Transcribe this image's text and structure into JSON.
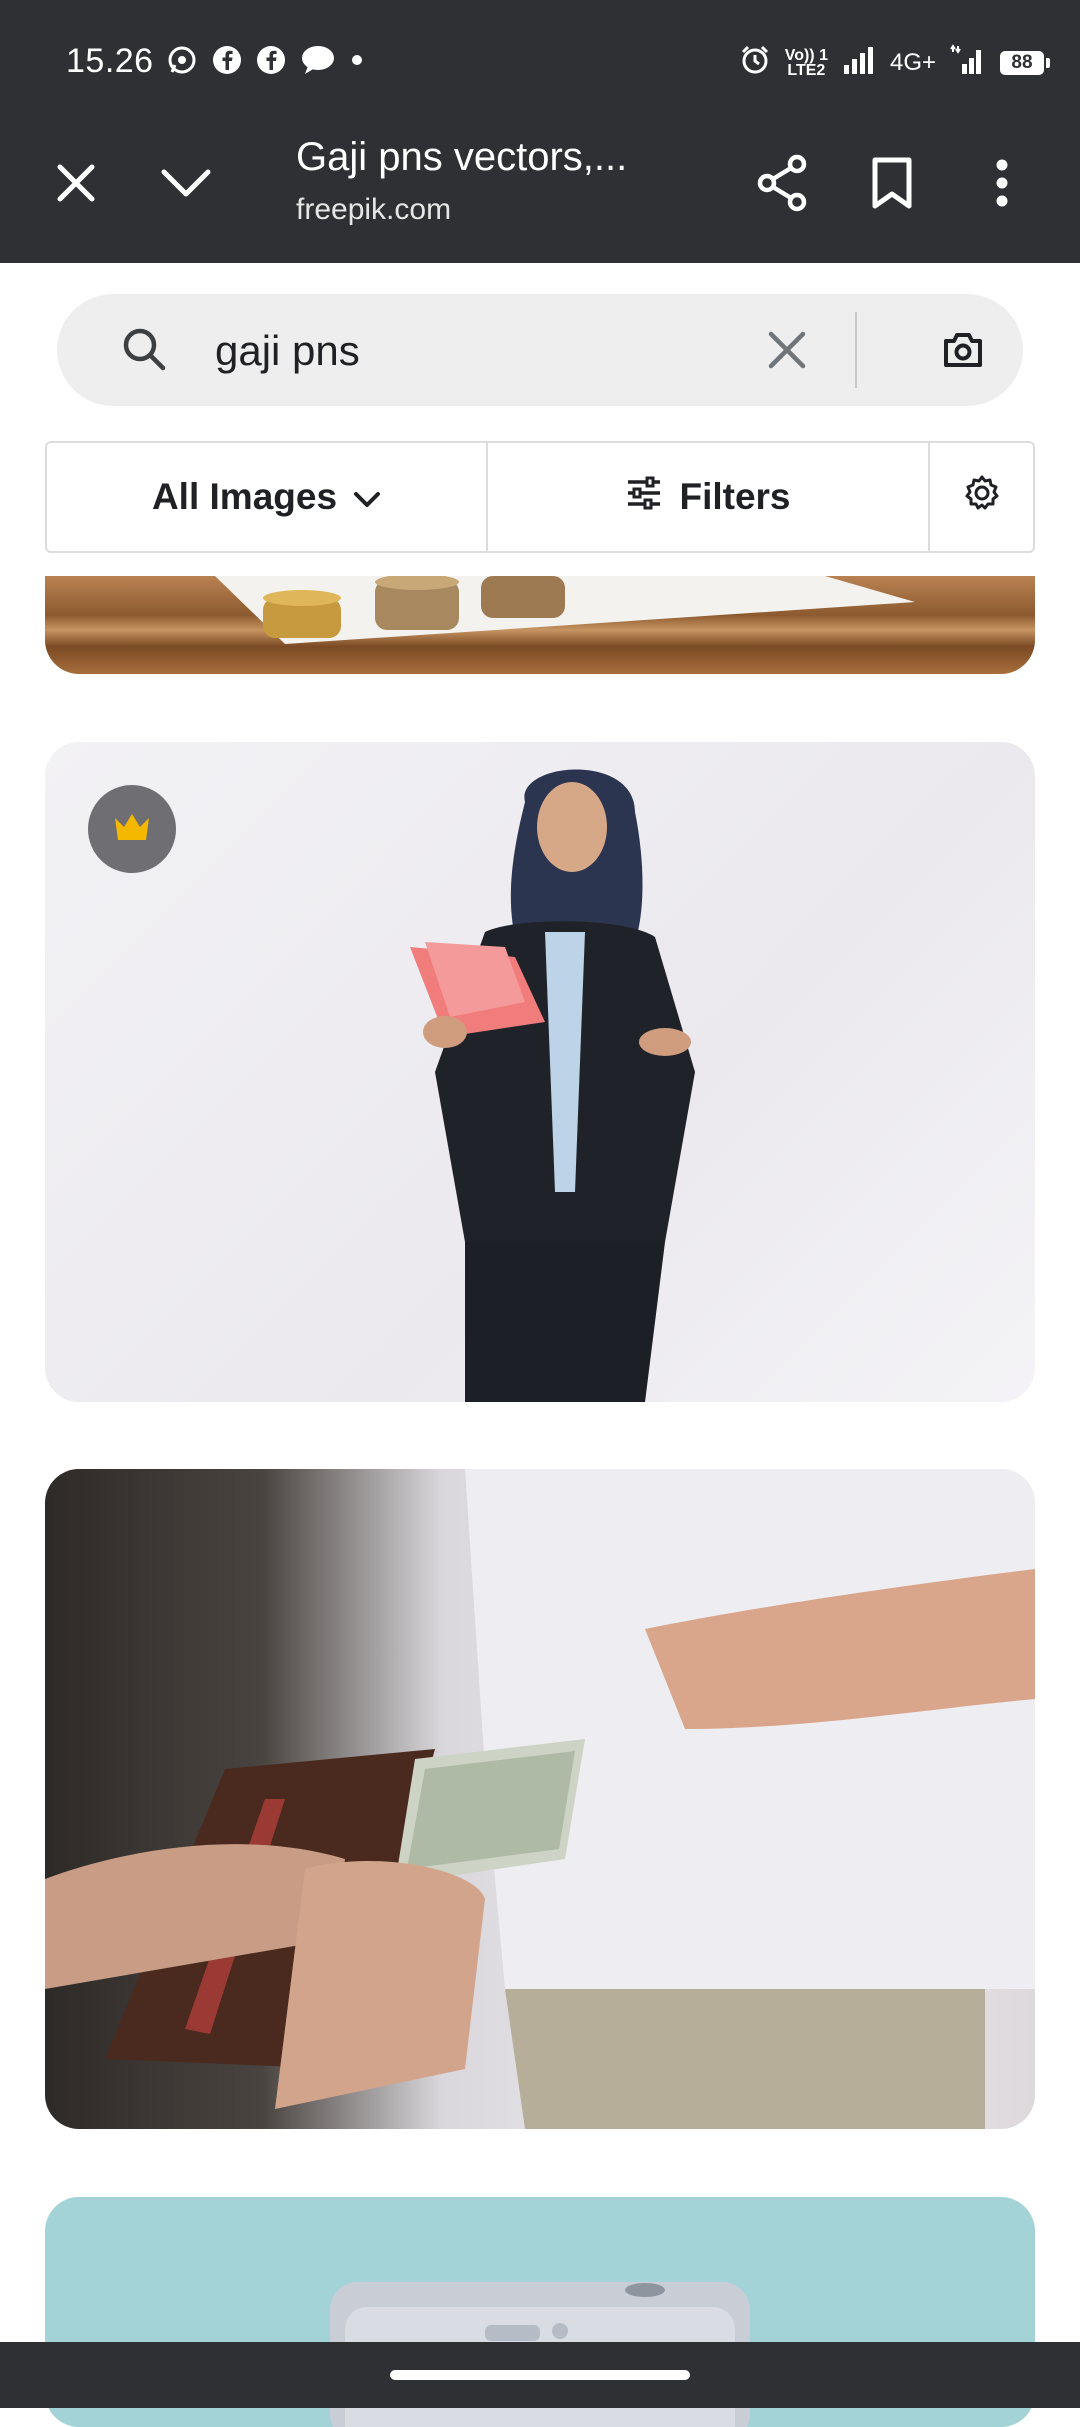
{
  "status_bar": {
    "time": "15.26",
    "notification_icons": [
      "whatsapp-icon",
      "facebook-icon",
      "facebook-icon",
      "chat-bubble-icon",
      "dot-icon"
    ],
    "volte_label_1": "Vo)) 1",
    "volte_label_2": "LTE2",
    "network_label": "4G+",
    "battery_level": "88"
  },
  "toolbar": {
    "page_title": "Gaji pns vectors,...",
    "domain": "freepik.com",
    "icons": [
      "close-icon",
      "chevron-down-icon",
      "share-icon",
      "bookmark-icon",
      "more-vert-icon"
    ]
  },
  "search": {
    "query": "gaji pns",
    "icons": [
      "search-icon",
      "clear-icon",
      "camera-icon"
    ]
  },
  "filters": {
    "all_images_label": "All Images",
    "filters_label": "Filters",
    "icons": [
      "chevron-down-icon",
      "sliders-icon",
      "gear-icon"
    ]
  },
  "results": [
    {
      "subject": "coins-on-wooden-table"
    },
    {
      "subject": "woman-in-hijab-holding-money",
      "premium": true
    },
    {
      "subject": "hands-exchanging-dollar-bills"
    },
    {
      "subject": "teal-illustration"
    }
  ],
  "colors": {
    "chrome_dark": "#2f3033",
    "search_bg": "#eeeeee",
    "premium_badge": "#6f6f73",
    "crown": "#f5b800"
  }
}
